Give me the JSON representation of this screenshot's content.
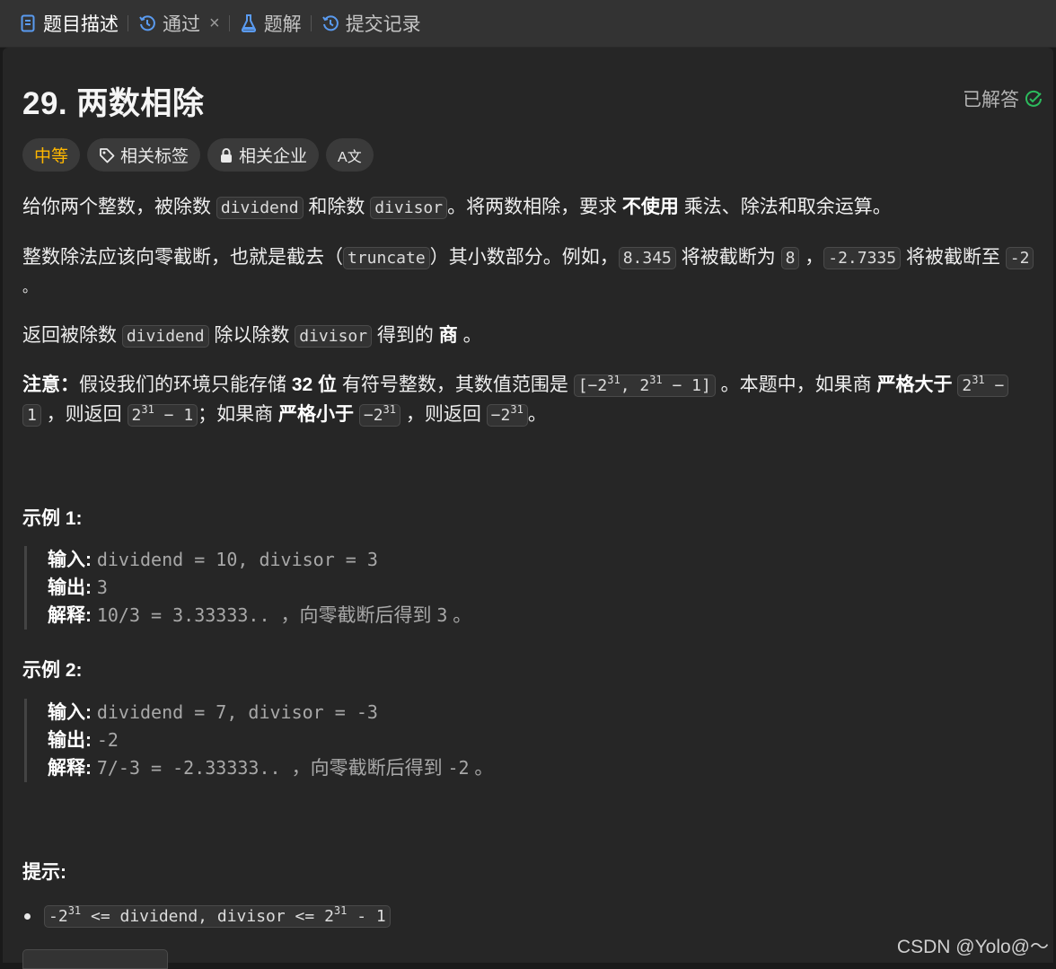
{
  "tabs": [
    {
      "label": "题目描述",
      "icon": "description-icon",
      "color": "#5a9bf0"
    },
    {
      "label": "通过",
      "icon": "history-icon",
      "color": "#5a9bf0"
    },
    {
      "label": "题解",
      "icon": "flask-icon",
      "color": "#5a9bf0"
    },
    {
      "label": "提交记录",
      "icon": "history-icon",
      "color": "#5a9bf0"
    }
  ],
  "tab_close_icon": "×",
  "problem": {
    "title": "29. 两数相除",
    "status": "已解答",
    "status_color": "#2cbb5d",
    "difficulty": "中等",
    "difficulty_color": "#ffb700",
    "tags": {
      "topics": "相关标签",
      "companies": "相关企业",
      "translate": "A文"
    }
  },
  "desc": {
    "p1": {
      "a": "给你两个整数，被除数 ",
      "c1": "dividend",
      "b": " 和除数 ",
      "c2": "divisor",
      "c": "。将两数相除，要求 ",
      "bold": "不使用",
      "d": " 乘法、除法和取余运算。"
    },
    "p2": {
      "a": "整数除法应该向零截断，也就是截去（",
      "c1": "truncate",
      "b": "）其小数部分。例如，",
      "c2": "8.345",
      "c": " 将被截断为 ",
      "c3": "8",
      "d": " ，",
      "c4": "-2.7335",
      "e": " 将被截断至 ",
      "c5": "-2",
      "f": "。"
    },
    "p3": {
      "a": "返回被除数 ",
      "c1": "dividend",
      "b": " 除以除数 ",
      "c2": "divisor",
      "c": " 得到的 ",
      "bold": "商",
      "d": " 。"
    },
    "p4": {
      "note": "注意：",
      "a": "假设我们的环境只能存储 ",
      "bold1": "32 位",
      "b": " 有符号整数，其数值范围是 ",
      "range_lo": "[−2",
      "range_hi": ",  2",
      "range_end": " − 1]",
      "exp": "31",
      "c": " 。本题中，如果商 ",
      "bold2": "严格大于",
      "g1": "2",
      "g1_tail": " −",
      "g2": "1",
      "d": " ，则返回 ",
      "g3": "2",
      "g3_tail": " − 1",
      "e": "；如果商 ",
      "bold3": "严格小于",
      "g4": "−2",
      "f": " ，则返回 ",
      "g5": "−2",
      "end": "。"
    }
  },
  "examples": [
    {
      "heading": "示例 1:",
      "input_label": "输入:",
      "input": "dividend = 10, divisor = 3",
      "output_label": "输出:",
      "output": "3",
      "explain_label": "解释:",
      "explain_code": "10/3 = 3.33333.. ",
      "explain_text": "，向零截断后得到 ",
      "explain_val": "3",
      "explain_end": " 。"
    },
    {
      "heading": "示例 2:",
      "input_label": "输入:",
      "input": "dividend = 7, divisor = -3",
      "output_label": "输出:",
      "output": "-2",
      "explain_label": "解释:",
      "explain_code": "7/-3 = -2.33333.. ",
      "explain_text": "，向零截断后得到 ",
      "explain_val": "-2",
      "explain_end": " 。"
    }
  ],
  "hints": {
    "heading": "提示:",
    "items": [
      {
        "a": "-2",
        "exp": "31",
        "b": " <= dividend, divisor <= 2",
        "exp2": "31",
        "c": " - 1"
      }
    ]
  },
  "watermark": "CSDN @Yolo@～"
}
